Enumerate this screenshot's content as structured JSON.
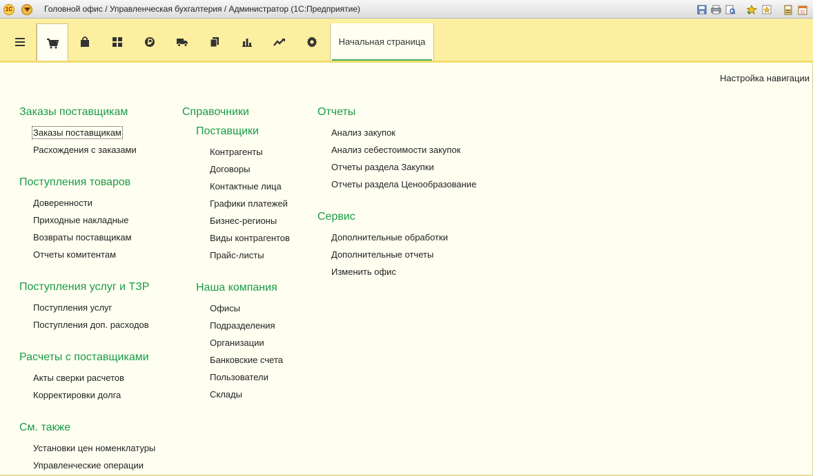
{
  "titlebar": {
    "title": "Головной офис / Управленческая бухгалтерия / Администратор  (1С:Предприятие)",
    "logo_text": "1С",
    "icons": [
      "save-icon",
      "print-icon",
      "print-preview-icon",
      "back-icon",
      "favorite-icon",
      "history-icon",
      "calculator-icon",
      "calendar-icon"
    ]
  },
  "sections_bar": {
    "icons": [
      "menu-icon",
      "cart-icon",
      "shopping-bag-icon",
      "grid-icon",
      "ruble-icon",
      "truck-icon",
      "documents-icon",
      "bar-chart-icon",
      "trend-icon",
      "gear-icon"
    ],
    "active_index": 1,
    "tab_label": "Начальная страница"
  },
  "nav_settings": "Настройка навигации",
  "columns": {
    "col1": {
      "groups": [
        {
          "title": "Заказы поставщикам",
          "items": [
            "Заказы поставщикам",
            "Расхождения с заказами"
          ]
        },
        {
          "title": "Поступления товаров",
          "items": [
            "Доверенности",
            "Приходные накладные",
            "Возвраты поставщикам",
            "Отчеты комитентам"
          ]
        },
        {
          "title": "Поступления услуг и ТЗР",
          "items": [
            "Поступления услуг",
            "Поступления доп. расходов"
          ]
        },
        {
          "title": "Расчеты с поставщиками",
          "items": [
            "Акты сверки расчетов",
            "Корректировки долга"
          ]
        },
        {
          "title": "См. также",
          "items": [
            "Установки цен номенклатуры",
            "Управленческие операции"
          ]
        }
      ]
    },
    "col2": {
      "title": "Справочники",
      "groups": [
        {
          "title": "Поставщики",
          "items": [
            "Контрагенты",
            "Договоры",
            "Контактные лица",
            "Графики платежей",
            "Бизнес-регионы",
            "Виды контрагентов",
            "Прайс-листы"
          ]
        },
        {
          "title": "Наша компания",
          "items": [
            "Офисы",
            "Подразделения",
            "Организации",
            "Банковские счета",
            "Пользователи",
            "Склады"
          ]
        }
      ]
    },
    "col3": {
      "groups": [
        {
          "title": "Отчеты",
          "items": [
            "Анализ закупок",
            "Анализ себестоимости закупок",
            "Отчеты раздела Закупки",
            "Отчеты раздела Ценообразование"
          ]
        },
        {
          "title": "Сервис",
          "items": [
            "Дополнительные обработки",
            "Дополнительные отчеты",
            "Изменить офис"
          ]
        }
      ]
    }
  },
  "colors": {
    "group_title": "#1a9a45",
    "toolbar_bg": "#fcf0a0",
    "page_bg": "#fffff1",
    "tab_underline": "#3fae5a"
  }
}
